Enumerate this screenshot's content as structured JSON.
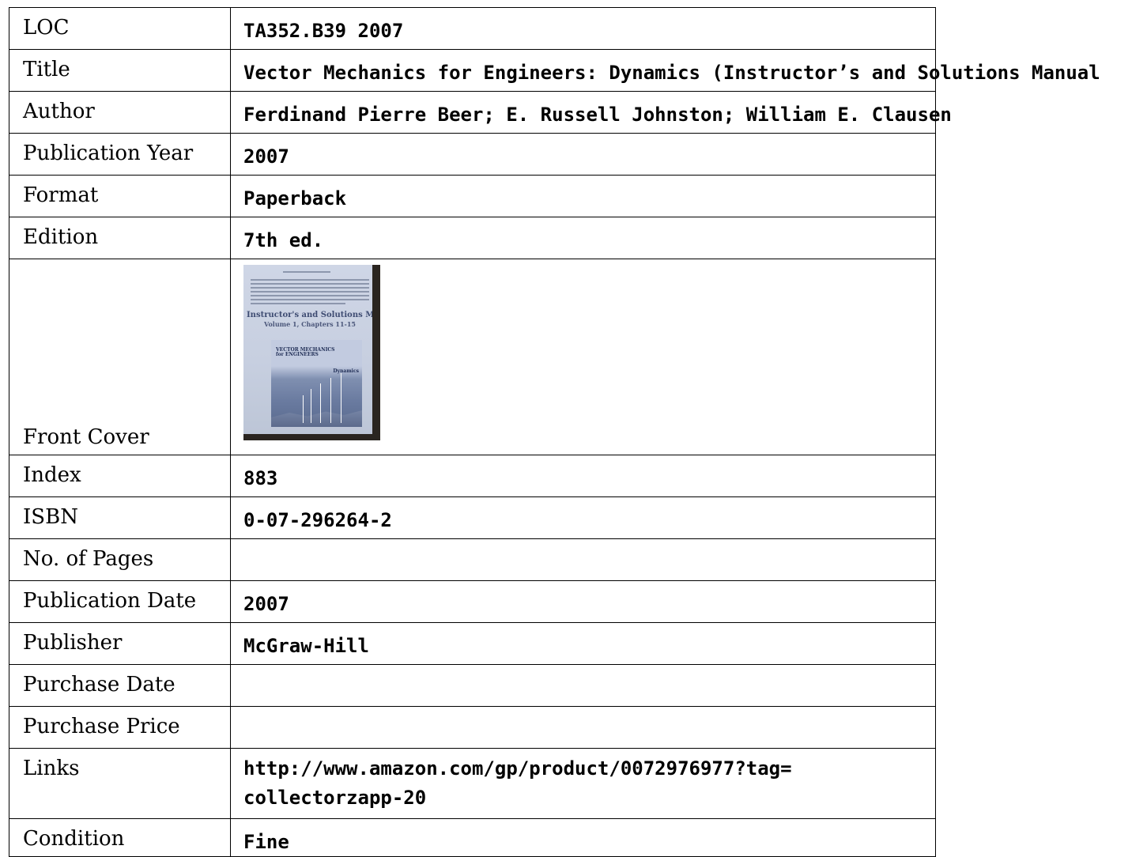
{
  "rows": [
    {
      "label": "LOC",
      "value": "TA352.B39 2007"
    },
    {
      "label": "Title",
      "value": "Vector Mechanics for Engineers: Dynamics (Instructor’s and Solutions Manual"
    },
    {
      "label": "Author",
      "value": "Ferdinand Pierre Beer; E. Russell Johnston; William E. Clausen"
    },
    {
      "label": "Publication Year",
      "value": "2007"
    },
    {
      "label": "Format",
      "value": "Paperback"
    },
    {
      "label": "Edition",
      "value": "7th ed."
    },
    {
      "label": "Front Cover",
      "value": ""
    },
    {
      "label": "Index",
      "value": "883"
    },
    {
      "label": "ISBN",
      "value": "0-07-296264-2"
    },
    {
      "label": "No. of Pages",
      "value": ""
    },
    {
      "label": "Publication Date",
      "value": "2007"
    },
    {
      "label": "Publisher",
      "value": "McGraw-Hill"
    },
    {
      "label": "Purchase Date",
      "value": ""
    },
    {
      "label": "Purchase Price",
      "value": ""
    },
    {
      "label": "Links",
      "value": "http://www.amazon.com/gp/product/0072976977?tag= collectorzapp-20"
    },
    {
      "label": "Condition",
      "value": "Fine"
    }
  ],
  "cover": {
    "manual_title": "Instructor's and Solutions Manual",
    "manual_sub": "Volume 1, Chapters 11-15",
    "accompany": "to accompany",
    "inner_title_1": "VECTOR MECHANICS",
    "inner_title_2": "for ENGINEERS",
    "inner_dynamics": "Dynamics"
  }
}
